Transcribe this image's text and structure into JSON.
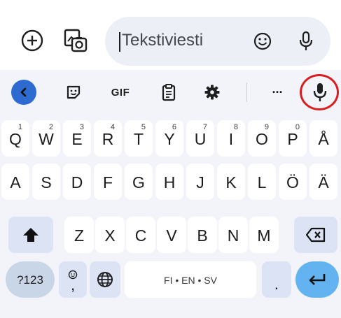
{
  "composer": {
    "placeholder": "Tekstiviesti"
  },
  "toolbar": {
    "gif_label": "GIF",
    "more_label": "···",
    "items": [
      "back-icon",
      "sticker-icon",
      "gif",
      "clipboard-icon",
      "gear-icon",
      "more-icon",
      "mic-icon"
    ],
    "highlighted_item": "mic-icon",
    "highlight_color": "#d91e1e"
  },
  "keyboard": {
    "row1": [
      {
        "label": "Q",
        "hint": "1"
      },
      {
        "label": "W",
        "hint": "2"
      },
      {
        "label": "E",
        "hint": "3"
      },
      {
        "label": "R",
        "hint": "4"
      },
      {
        "label": "T",
        "hint": "5"
      },
      {
        "label": "Y",
        "hint": "6"
      },
      {
        "label": "U",
        "hint": "7"
      },
      {
        "label": "I",
        "hint": "8"
      },
      {
        "label": "O",
        "hint": "9"
      },
      {
        "label": "P",
        "hint": "0"
      },
      {
        "label": "Å",
        "hint": ""
      }
    ],
    "row2": [
      "A",
      "S",
      "D",
      "F",
      "G",
      "H",
      "J",
      "K",
      "L",
      "Ö",
      "Ä"
    ],
    "row3": [
      "Z",
      "X",
      "C",
      "V",
      "B",
      "N",
      "M"
    ],
    "symbols_label": "?123",
    "comma_label": ",",
    "space_label": "FI • EN • SV",
    "period_label": ".",
    "colors": {
      "key": "#ffffff",
      "modifier": "#dbe3f5",
      "enter": "#62b3f0",
      "accent": "#2e6bd1"
    }
  }
}
